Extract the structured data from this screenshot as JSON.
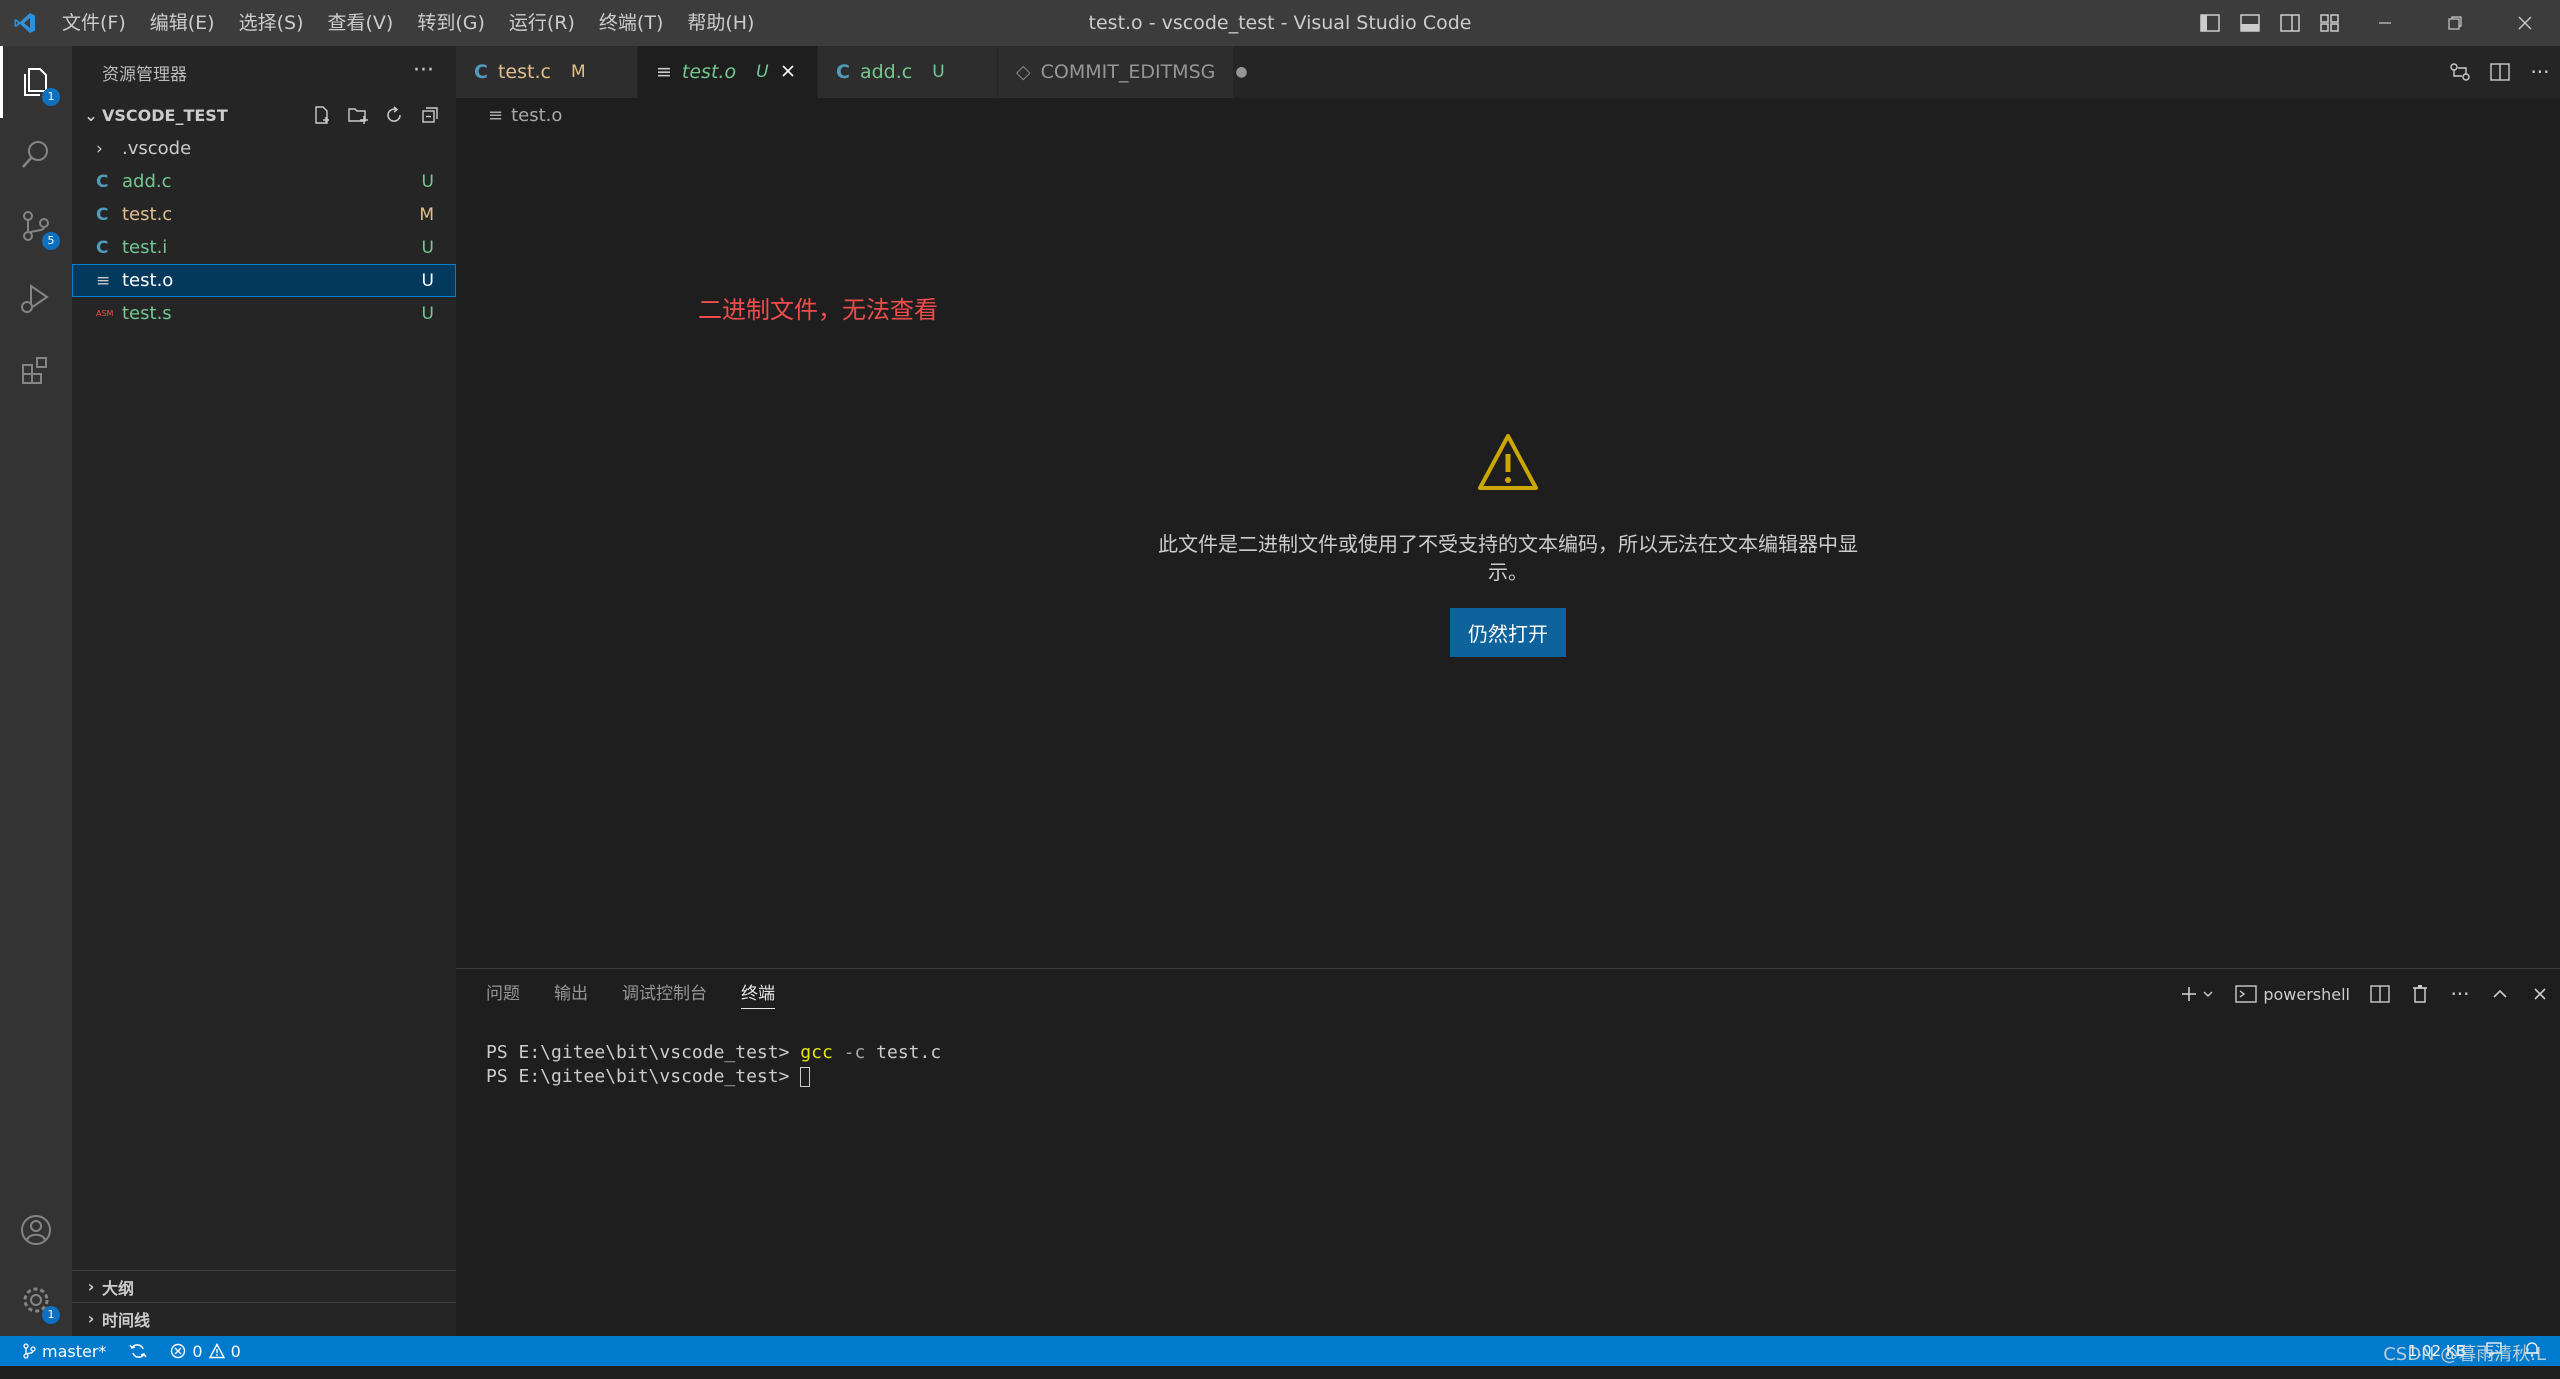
{
  "window_title": "test.o - vscode_test - Visual Studio Code",
  "menu": [
    "文件(F)",
    "编辑(E)",
    "选择(S)",
    "查看(V)",
    "转到(G)",
    "运行(R)",
    "终端(T)",
    "帮助(H)"
  ],
  "activity": {
    "explorer_badge": "1",
    "scm_badge": "5",
    "settings_badge": "1"
  },
  "sidebar": {
    "title": "资源管理器",
    "more": "···",
    "folder": "VSCODE_TEST",
    "files": [
      {
        "name": ".vscode",
        "icon": "›",
        "status": ""
      },
      {
        "name": "add.c",
        "icon": "C",
        "status": "U"
      },
      {
        "name": "test.c",
        "icon": "C",
        "status": "M"
      },
      {
        "name": "test.i",
        "icon": "C",
        "status": "U"
      },
      {
        "name": "test.o",
        "icon": "≡",
        "status": "U"
      },
      {
        "name": "test.s",
        "icon": "ASM",
        "status": "U"
      }
    ],
    "outline": "大纲",
    "timeline": "时间线"
  },
  "tabs": [
    {
      "label": "test.c",
      "icon": "C",
      "status": "M"
    },
    {
      "label": "test.o",
      "icon": "≡",
      "status": "U"
    },
    {
      "label": "add.c",
      "icon": "C",
      "status": "U"
    },
    {
      "label": "COMMIT_EDITMSG",
      "icon": "◇",
      "status": "●"
    }
  ],
  "breadcrumb": "test.o",
  "editor": {
    "annotation": "二进制文件，无法查看",
    "message": "此文件是二进制文件或使用了不受支持的文本编码，所以无法在文本编辑器中显示。",
    "open_button": "仍然打开"
  },
  "panel": {
    "tabs": [
      "问题",
      "输出",
      "调试控制台",
      "终端"
    ],
    "shell": "powershell",
    "prompt": "PS E:\\gitee\\bit\\vscode_test>",
    "cmd": "gcc",
    "flag": "-c",
    "arg": "test.c"
  },
  "status": {
    "branch": "master*",
    "errors": "0",
    "warnings": "0",
    "size": "1.02 KB"
  },
  "watermark": "CSDN @暮雨清秋.L",
  "colors": {
    "accent": "#007acc",
    "selected": "#04395e",
    "untracked": "#73c991",
    "modified": "#e2c08d",
    "warning": "#cca700",
    "annotation": "#f14c4c"
  }
}
